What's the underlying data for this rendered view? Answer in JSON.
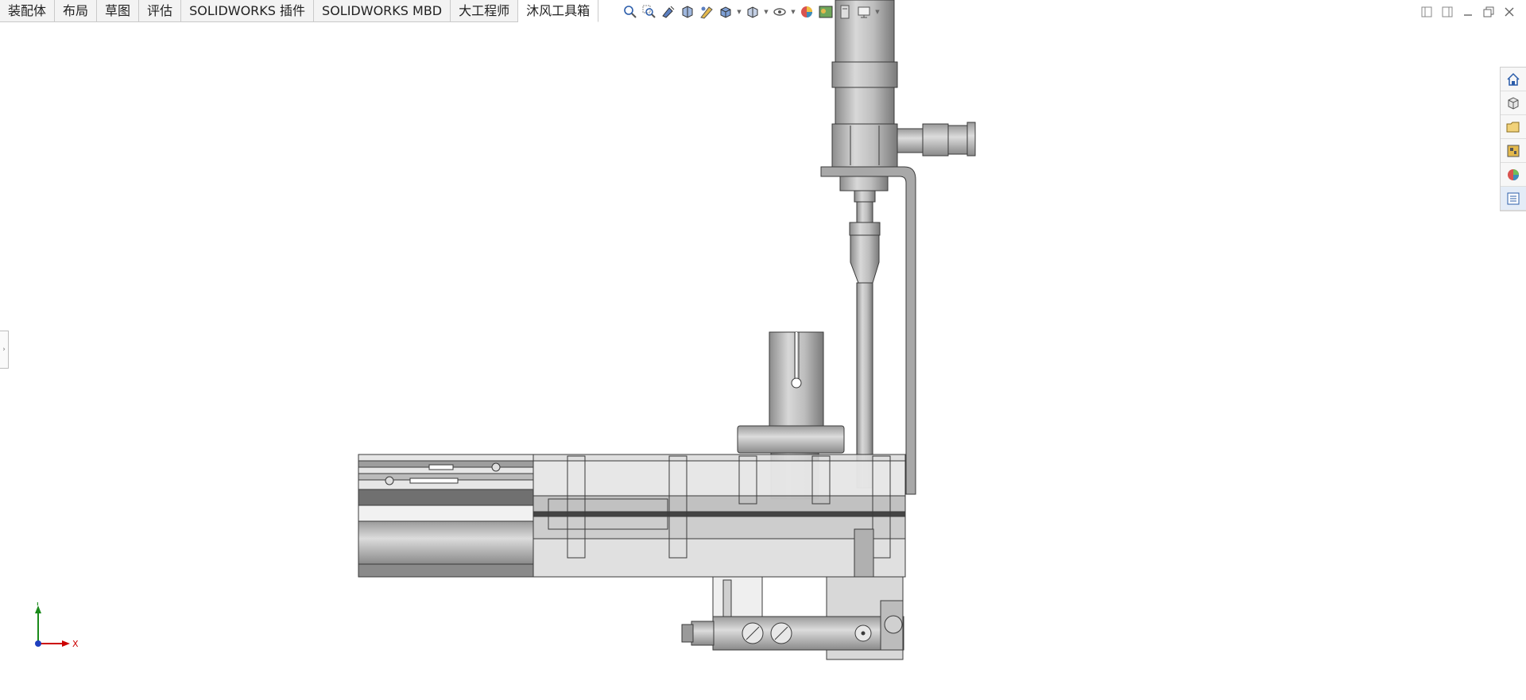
{
  "tabs": [
    {
      "label": "装配体"
    },
    {
      "label": "布局"
    },
    {
      "label": "草图"
    },
    {
      "label": "评估"
    },
    {
      "label": "SOLIDWORKS 插件"
    },
    {
      "label": "SOLIDWORKS MBD"
    },
    {
      "label": "大工程师"
    },
    {
      "label": "沐风工具箱",
      "active": true
    }
  ],
  "hud_icons": [
    "zoom-to-fit-icon",
    "zoom-to-area-icon",
    "previous-view-icon",
    "section-view-icon",
    "dynamic-annotation-icon",
    "view-orientation-icon",
    "display-style-icon",
    "hide-show-items-icon",
    "edit-appearance-icon",
    "apply-scene-icon",
    "view-settings-icon",
    "display-monitor-icon"
  ],
  "triad": {
    "x_label": "X",
    "y_label": "Y"
  },
  "colors": {
    "accent": "#1f5fbf",
    "tab_bg": "#f3f3f3",
    "metal_dark": "#6e6e6e",
    "metal_light": "#d2d2d2"
  }
}
